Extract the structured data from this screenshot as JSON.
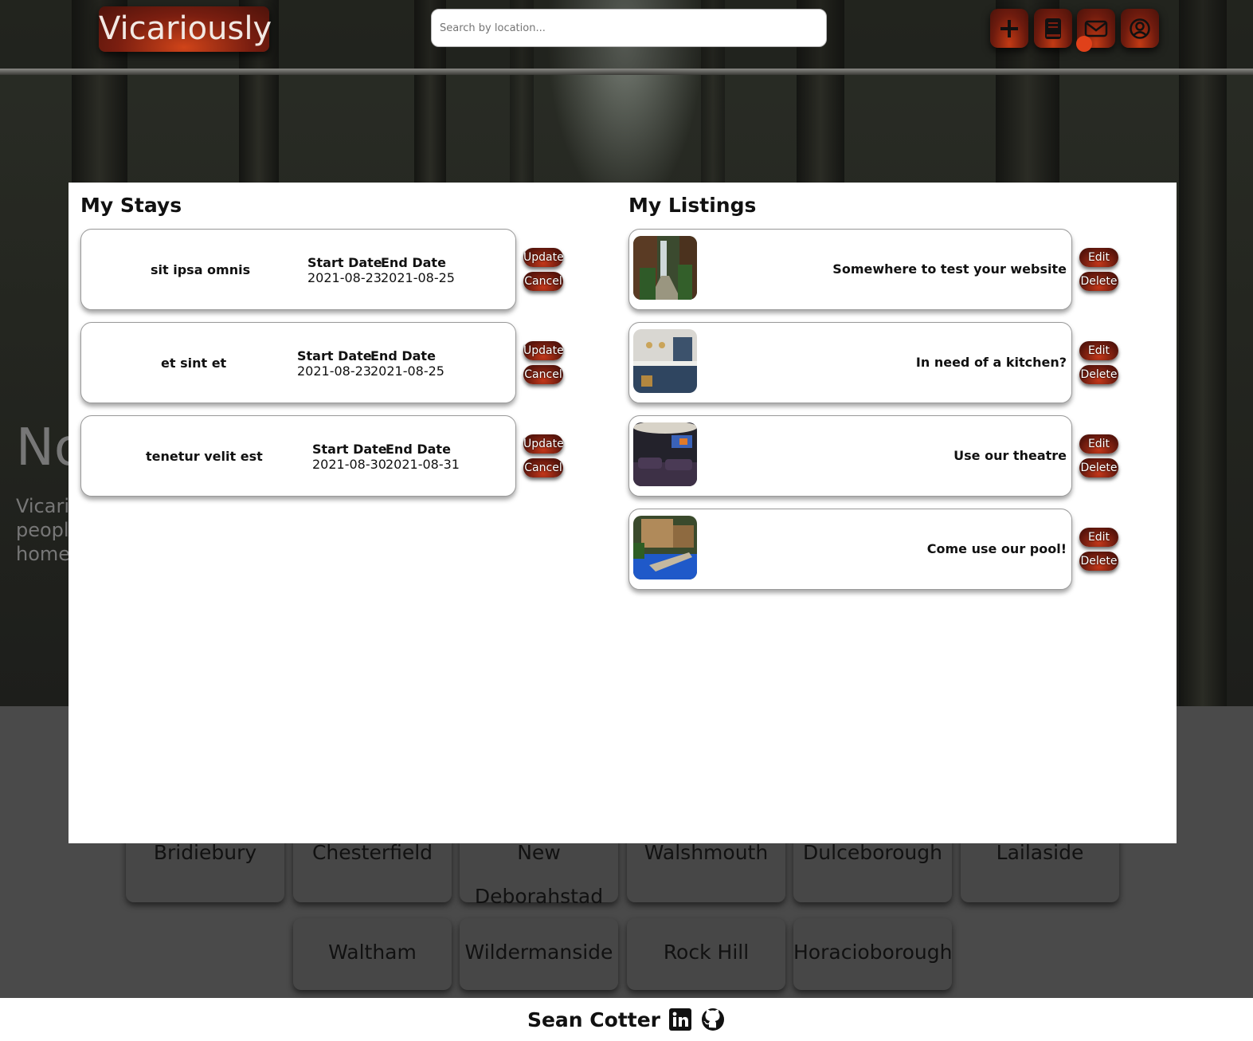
{
  "app": {
    "logo": "Vicariously",
    "search_placeholder": "Search by location...",
    "nav_icons": [
      "plus-icon",
      "book-icon",
      "mail-icon",
      "user-circle-icon"
    ]
  },
  "hero": {
    "title_partial": "No",
    "subtitle_partial": "Vicari\npeople\nhome"
  },
  "modal": {
    "stays_heading": "My Stays",
    "listings_heading": "My Listings",
    "stays": [
      {
        "name": "sit ipsa omnis",
        "start_label": "Start Date",
        "start": "2021-08-23",
        "end_label": "End Date",
        "end": "2021-08-25",
        "update": "Update",
        "cancel": "Cancel"
      },
      {
        "name": "et sint et",
        "start_label": "Start Date",
        "start": "2021-08-23",
        "end_label": "End Date",
        "end": "2021-08-25",
        "update": "Update",
        "cancel": "Cancel"
      },
      {
        "name": "tenetur velit est",
        "start_label": "Start Date",
        "start": "2021-08-30",
        "end_label": "End Date",
        "end": "2021-08-31",
        "update": "Update",
        "cancel": "Cancel"
      }
    ],
    "listings": [
      {
        "title": "Somewhere to test your website",
        "edit": "Edit",
        "delete": "Delete"
      },
      {
        "title": "In need of a kitchen?",
        "edit": "Edit",
        "delete": "Delete"
      },
      {
        "title": "Use our theatre",
        "edit": "Edit",
        "delete": "Delete"
      },
      {
        "title": "Come use our pool!",
        "edit": "Edit",
        "delete": "Delete"
      }
    ]
  },
  "cities": {
    "row1": [
      "Bridiebury",
      "Chesterfield",
      "New Deborahstad",
      "Walshmouth",
      "Dulceborough",
      "Lailaside"
    ],
    "row2": [
      "Waltham",
      "Wildermanside",
      "Rock Hill",
      "Horacioborough"
    ]
  },
  "footer": {
    "name": "Sean Cotter",
    "icons": [
      "linkedin-icon",
      "github-icon"
    ]
  },
  "colors": {
    "accent": "#c23a14",
    "accent_dark": "#5e160c",
    "notification": "#e0411a"
  }
}
